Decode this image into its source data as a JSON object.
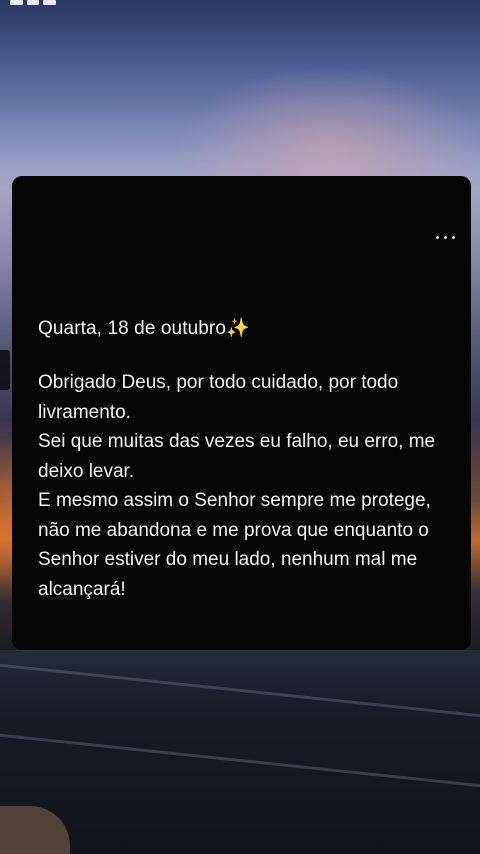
{
  "note": {
    "date": "Quarta, 18 de outubro✨",
    "lines": [
      "Obrigado Deus, por todo cuidado, por todo livramento.",
      "Sei que muitas das vezes eu falho, eu erro, me deixo levar.",
      "E mesmo assim o Senhor sempre me protege, não me abandona e me prova que enquanto o Senhor estiver do meu lado, nenhum mal me alcançará!"
    ]
  },
  "icons": {
    "menu": "more-horizontal-icon"
  }
}
